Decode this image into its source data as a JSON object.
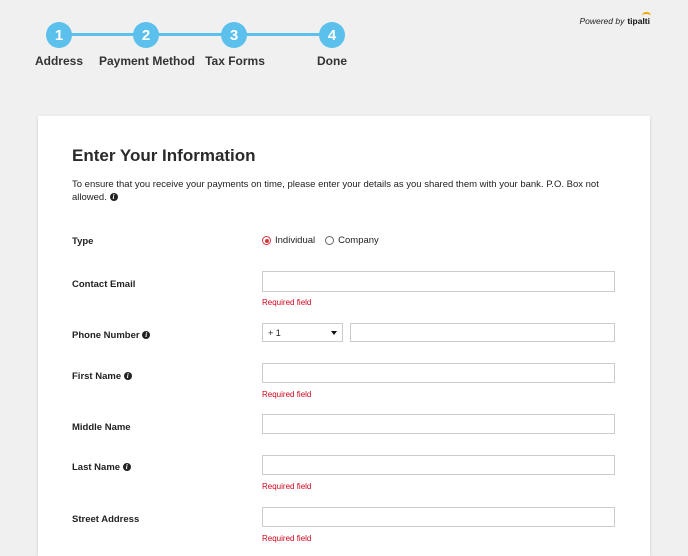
{
  "stepper": {
    "steps": [
      {
        "number": "1",
        "label": "Address"
      },
      {
        "number": "2",
        "label": "Payment Method"
      },
      {
        "number": "3",
        "label": "Tax Forms"
      },
      {
        "number": "4",
        "label": "Done"
      }
    ],
    "accent": "#5bc0eb"
  },
  "powered_by": {
    "text": "Powered by",
    "logo": "tipalti"
  },
  "form": {
    "title": "Enter Your Information",
    "intro": "To ensure that you receive your payments on time, please enter your details as you shared them with your bank. P.O. Box not allowed.",
    "type_label": "Type",
    "type_options": [
      "Individual",
      "Company"
    ],
    "type_selected": "Individual",
    "contact_email_label": "Contact Email",
    "required_text": "Required field",
    "phone_label": "Phone Number",
    "phone_code": "+ 1",
    "first_name_label": "First Name",
    "middle_name_label": "Middle Name",
    "last_name_label": "Last Name",
    "street_address_label": "Street Address",
    "error_color": "#d0021b"
  }
}
